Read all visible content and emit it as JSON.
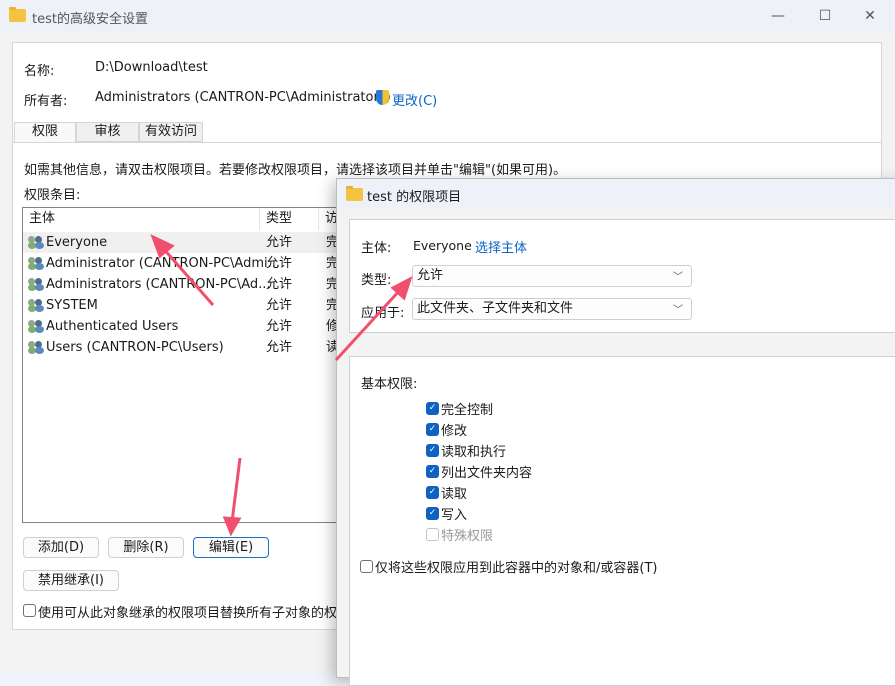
{
  "main": {
    "title": "test的高级安全设置",
    "name_label": "名称:",
    "name_value": "D:\\Download\\test",
    "owner_label": "所有者:",
    "owner_value": "Administrators (CANTRON-PC\\Administrators)",
    "change_link": "更改(C)",
    "tabs": [
      "权限",
      "审核",
      "有效访问"
    ],
    "info_text": "如需其他信息，请双击权限项目。若要修改权限项目，请选择该项目并单击\"编辑\"(如果可用)。",
    "entries_label": "权限条目:",
    "columns": [
      "主体",
      "类型",
      "访"
    ],
    "rows": [
      {
        "principal": "Everyone",
        "type": "允许",
        "access": "完"
      },
      {
        "principal": "Administrator (CANTRON-PC\\Admi...",
        "type": "允许",
        "access": "完"
      },
      {
        "principal": "Administrators (CANTRON-PC\\Ad...",
        "type": "允许",
        "access": "完"
      },
      {
        "principal": "SYSTEM",
        "type": "允许",
        "access": "完"
      },
      {
        "principal": "Authenticated Users",
        "type": "允许",
        "access": "修"
      },
      {
        "principal": "Users (CANTRON-PC\\Users)",
        "type": "允许",
        "access": "读"
      }
    ],
    "add_button": "添加(D)",
    "remove_button": "删除(R)",
    "edit_button": "编辑(E)",
    "disable_inheritance_button": "禁用继承(I)",
    "replace_checkbox": "使用可从此对象继承的权限项目替换所有子对象的权"
  },
  "dialog": {
    "title": "test 的权限项目",
    "principal_label": "主体:",
    "principal_value": "Everyone",
    "select_principal": "选择主体",
    "type_label": "类型:",
    "type_value": "允许",
    "applies_label": "应用于:",
    "applies_value": "此文件夹、子文件夹和文件",
    "basic_label": "基本权限:",
    "permissions": [
      {
        "label": "完全控制",
        "checked": true
      },
      {
        "label": "修改",
        "checked": true
      },
      {
        "label": "读取和执行",
        "checked": true
      },
      {
        "label": "列出文件夹内容",
        "checked": true
      },
      {
        "label": "读取",
        "checked": true
      },
      {
        "label": "写入",
        "checked": true
      },
      {
        "label": "特殊权限",
        "checked": false,
        "disabled": true
      }
    ],
    "only_apply_checkbox": "仅将这些权限应用到此容器中的对象和/或容器(T)"
  },
  "colors": {
    "accent": "#0f62c2",
    "arrow": "#f0506e"
  }
}
